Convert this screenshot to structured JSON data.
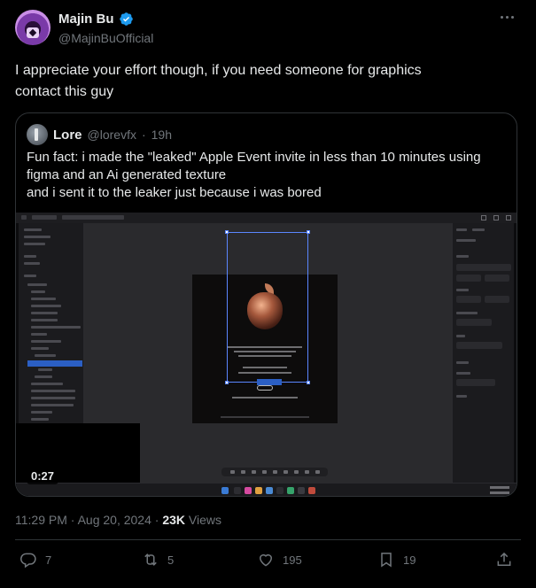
{
  "author": {
    "name": "Majin Bu",
    "handle": "@MajinBuOfficial",
    "verified_icon": "verified-badge-icon"
  },
  "tweet": {
    "text_line1": "I appreciate your effort though, if you need someone for graphics",
    "text_line2": "contact this guy"
  },
  "quoted": {
    "name": "Lore",
    "handle": "@lorevfx",
    "separator": "·",
    "time": "19h",
    "text_line1": "Fun fact: i made the \"leaked\" Apple Event invite in less than 10 minutes using",
    "text_line2": "figma and an Ai generated texture",
    "text_line3": "and i sent it to the leaker just because i was bored",
    "video": {
      "duration": "0:27"
    }
  },
  "meta": {
    "time": "11:29 PM",
    "sep": "·",
    "date": "Aug 20, 2024",
    "sep2": "·",
    "views_count": "23K",
    "views_label": "Views"
  },
  "actions": {
    "replies": "7",
    "reposts": "5",
    "likes": "195",
    "bookmarks": "19"
  },
  "colors": {
    "background": "#000000",
    "text": "#e7e9ea",
    "muted": "#71767b",
    "border": "#2f3336",
    "verified": "#1d9bf0"
  }
}
